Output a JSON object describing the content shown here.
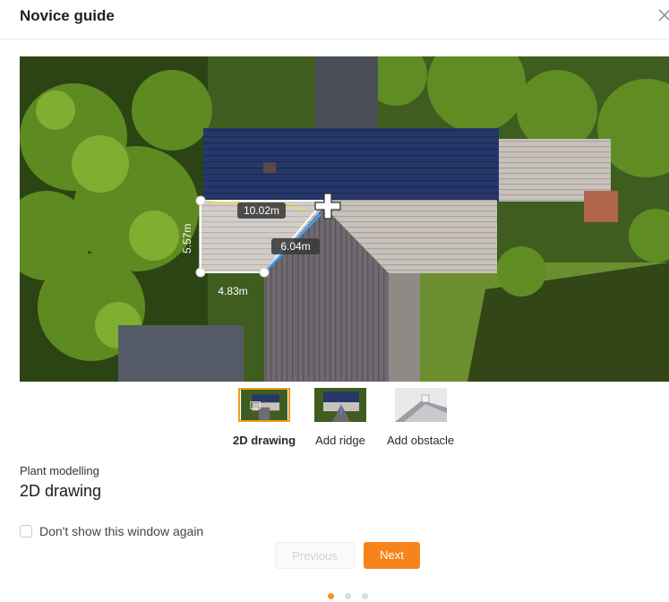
{
  "dialog": {
    "title": "Novice guide",
    "close_icon": "close-icon"
  },
  "hero": {
    "measurements": {
      "top_edge": "10.02m",
      "left_edge": "5.57m",
      "bottom_edge": "4.83m",
      "diagonal": "6.04m"
    }
  },
  "steps": [
    {
      "label": "2D drawing",
      "active": true
    },
    {
      "label": "Add ridge",
      "active": false
    },
    {
      "label": "Add obstacle",
      "active": false
    }
  ],
  "section": {
    "category": "Plant modelling",
    "title": "2D drawing"
  },
  "dont_show": {
    "label": "Don't show this window again",
    "checked": false
  },
  "buttons": {
    "previous": "Previous",
    "next": "Next"
  },
  "pagination": {
    "total": 3,
    "current": 1
  },
  "colors": {
    "accent": "#f7831c",
    "dot_inactive": "#dcdcdc"
  }
}
